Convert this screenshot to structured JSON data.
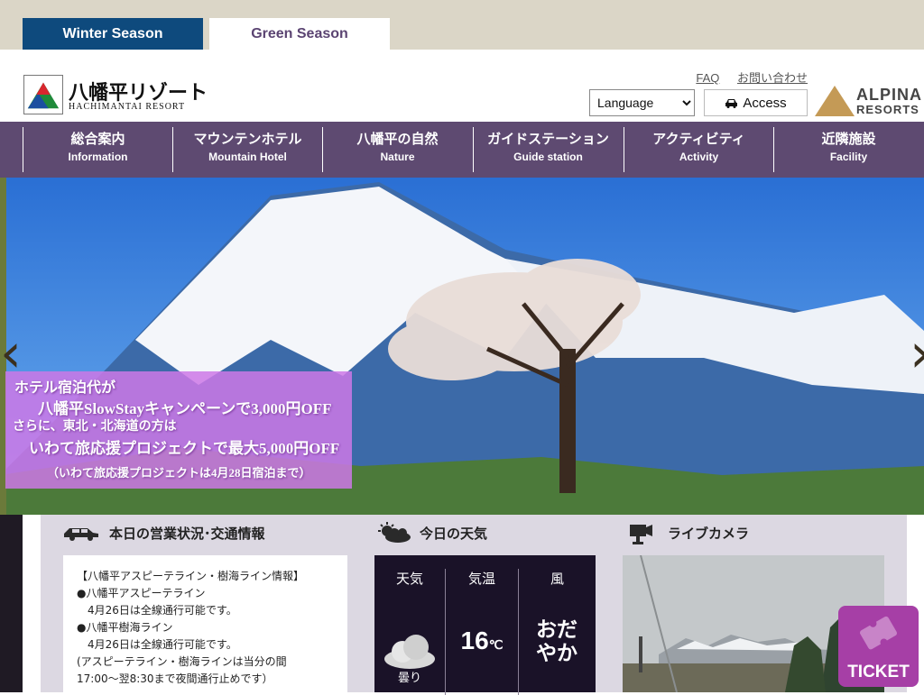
{
  "season_tabs": {
    "winter": "Winter Season",
    "green": "Green Season"
  },
  "logo": {
    "ja": "八幡平リゾート",
    "en": "HACHIMANTAI RESORT"
  },
  "top_links": {
    "faq": "FAQ",
    "contact": "お問い合わせ"
  },
  "language_select": {
    "value": "Language"
  },
  "access": {
    "label": "Access",
    "icon": "car-icon"
  },
  "partner_logo": {
    "line1": "ALPINA",
    "line2": "RESORTS"
  },
  "nav": [
    {
      "ja": "総合案内",
      "en": "Information"
    },
    {
      "ja": "マウンテンホテル",
      "en": "Mountain Hotel"
    },
    {
      "ja": "八幡平の自然",
      "en": "Nature"
    },
    {
      "ja": "ガイドステーション",
      "en": "Guide station"
    },
    {
      "ja": "アクティビティ",
      "en": "Activity"
    },
    {
      "ja": "近隣施設",
      "en": "Facility"
    }
  ],
  "hero": {
    "prev_arrow": "‹",
    "next_arrow": "›",
    "promo": {
      "line1": "ホテル宿泊代が",
      "line2": "八幡平SlowStayキャンペーンで3,000円OFF",
      "line3": "さらに、東北・北海道の方は",
      "line4": "いわて旅応援プロジェクトで最大5,000円OFF",
      "line5": "（いわて旅応援プロジェクトは4月28日宿泊まで）"
    }
  },
  "traffic": {
    "title": "本日の営業状況･交通情報",
    "body": "【八幡平アスピーテライン・樹海ライン情報】\n●八幡平アスピーテライン\n　4月26日は全線通行可能です。\n●八幡平樹海ライン\n　4月26日は全線通行可能です。\n(アスピーテライン・樹海ラインは当分の間\n17:00～翌8:30まで夜間通行止めです）"
  },
  "weather": {
    "title": "今日の天気",
    "col_weather": "天気",
    "col_temp": "気温",
    "col_wind": "風",
    "condition": "曇り",
    "temp_value": "16",
    "temp_unit": "℃",
    "wind": "おだやか"
  },
  "livecam": {
    "title": "ライブカメラ"
  },
  "ticket": {
    "label": "TICKET"
  },
  "colors": {
    "nav_bg": "#5e4a71",
    "winter_tab": "#0e4a7d",
    "ticket": "#a63fa6",
    "promo": "#cd78e6"
  }
}
